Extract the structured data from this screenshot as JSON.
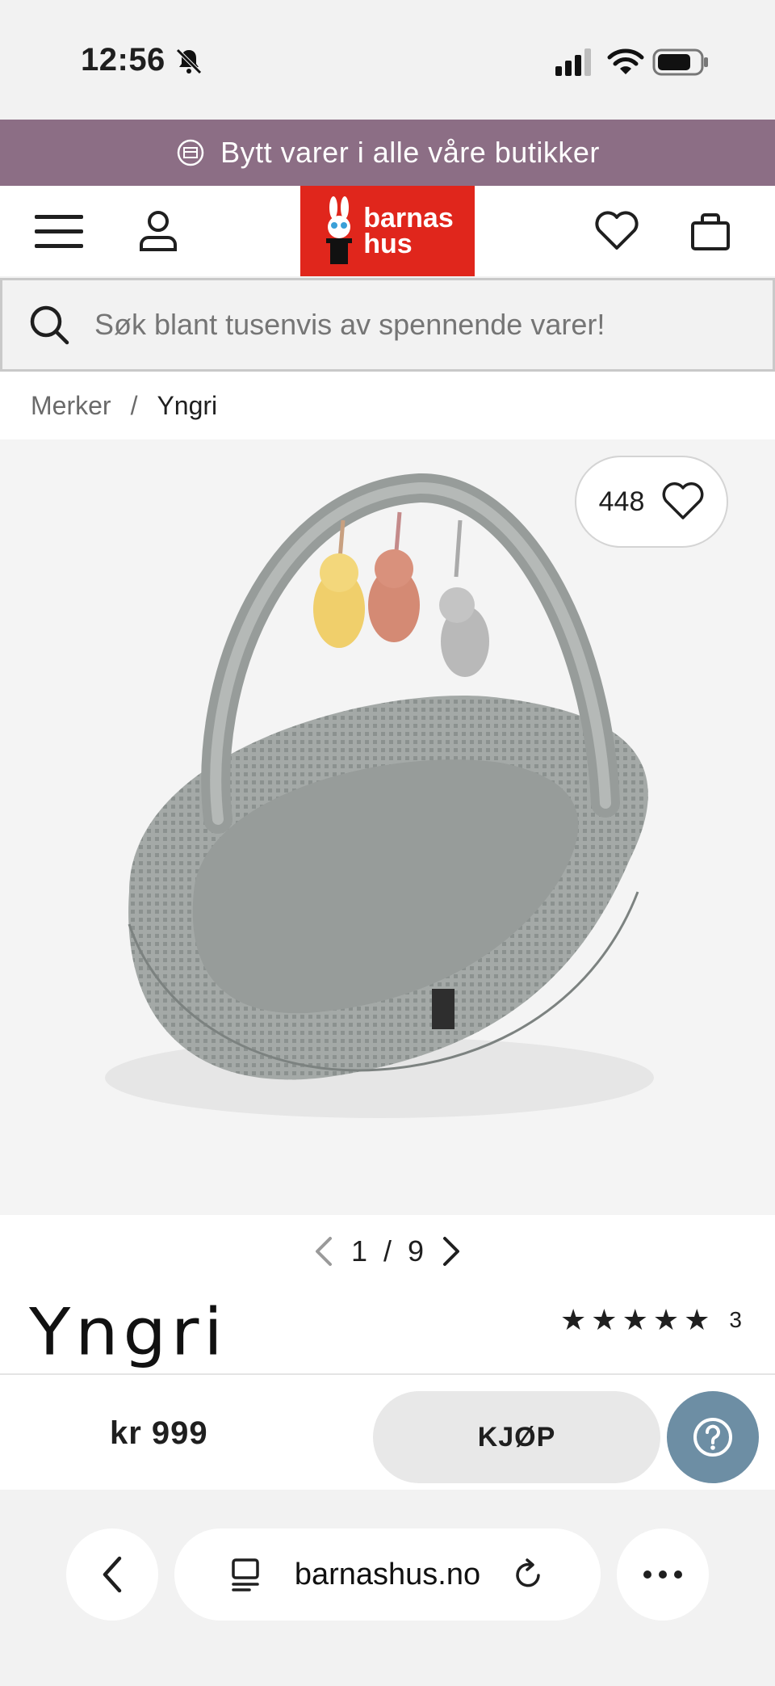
{
  "status_bar": {
    "time": "12:56"
  },
  "promo": {
    "text": "Bytt varer i alle våre butikker"
  },
  "header": {
    "logo_line1": "barnas",
    "logo_line2": "hus"
  },
  "search": {
    "placeholder": "Søk blant tusenvis av spennende varer!"
  },
  "breadcrumb": {
    "items": [
      "Merker",
      "Yngri"
    ],
    "separator": "/"
  },
  "product": {
    "wishlist_count": "448",
    "pager_current": "1",
    "pager_separator": "/",
    "pager_total": "9",
    "brand": "Yngri",
    "rating_stars": 5,
    "rating_count": "3",
    "price": "kr 999",
    "buy_label": "KJØP"
  },
  "browser": {
    "url": "barnashus.no"
  },
  "colors": {
    "promo": "#8c6e85",
    "logo": "#e0261c",
    "help": "#6d8ea4"
  }
}
